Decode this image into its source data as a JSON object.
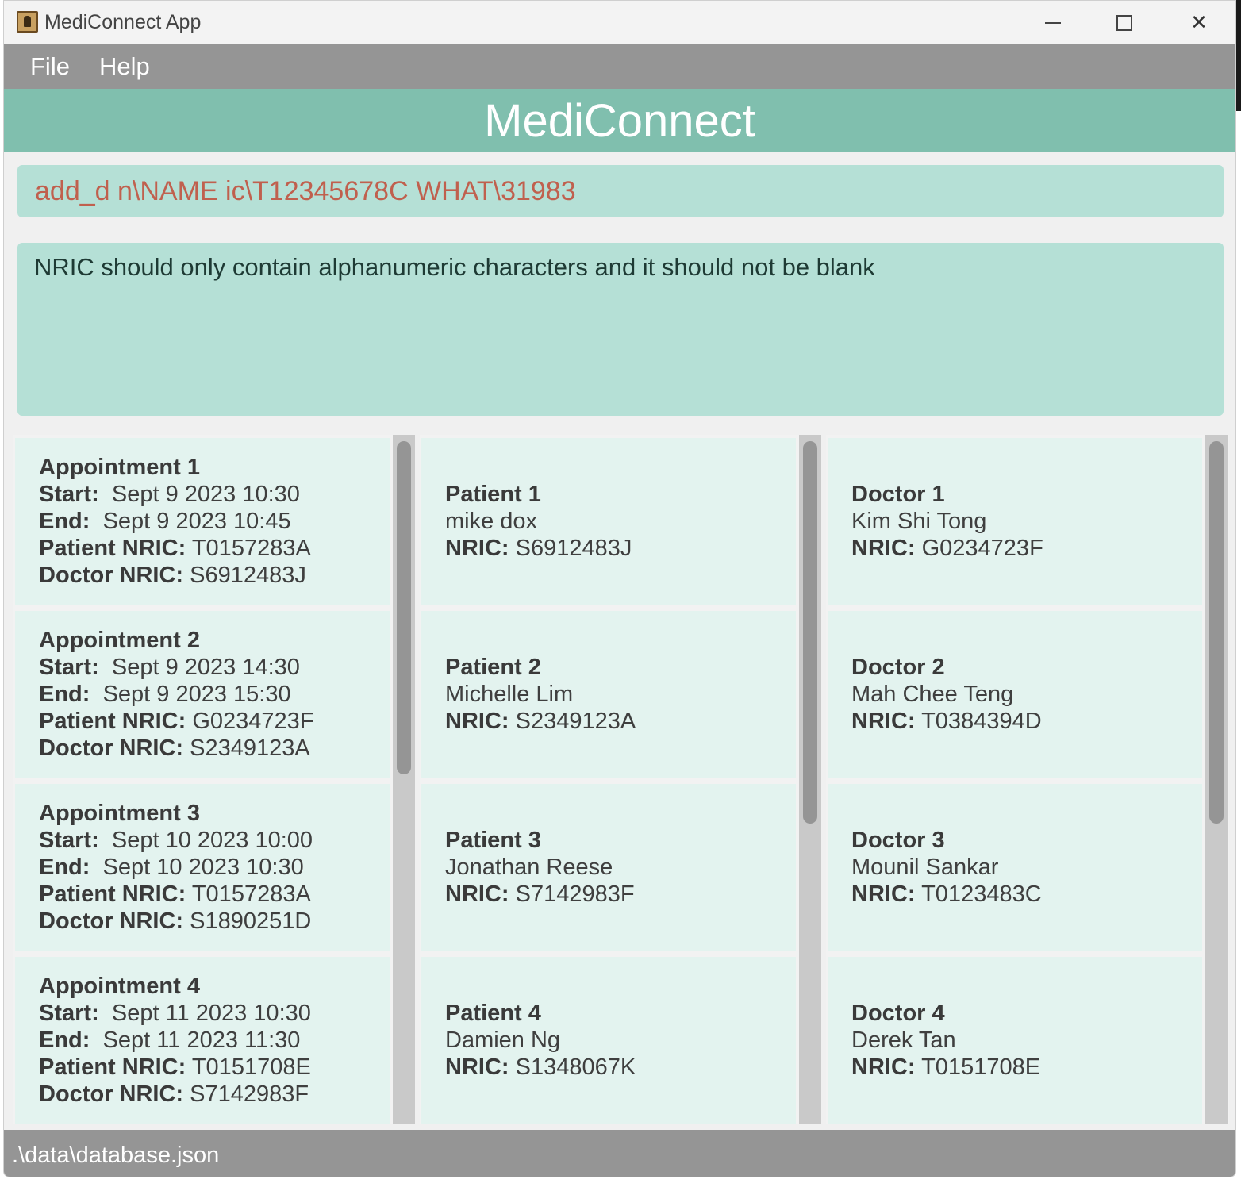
{
  "window": {
    "title": "MediConnect App"
  },
  "menu": {
    "file": "File",
    "help": "Help"
  },
  "banner": {
    "title": "MediConnect"
  },
  "command": {
    "value": "add_d n\\NAME ic\\T12345678C WHAT\\31983"
  },
  "result": {
    "message": "NRIC should only contain alphanumeric characters and it should not be blank"
  },
  "labels": {
    "start": "Start:",
    "end": "End:",
    "patient_nric": "Patient NRIC:",
    "doctor_nric": "Doctor NRIC:",
    "nric": "NRIC:"
  },
  "appointments": [
    {
      "title": "Appointment 1",
      "start": "Sept 9 2023 10:30",
      "end": "Sept 9 2023 10:45",
      "patient_nric": "T0157283A",
      "doctor_nric": "S6912483J"
    },
    {
      "title": "Appointment 2",
      "start": "Sept 9 2023 14:30",
      "end": "Sept 9 2023 15:30",
      "patient_nric": "G0234723F",
      "doctor_nric": "S2349123A"
    },
    {
      "title": "Appointment 3",
      "start": "Sept 10 2023 10:00",
      "end": "Sept 10 2023 10:30",
      "patient_nric": "T0157283A",
      "doctor_nric": "S1890251D"
    },
    {
      "title": "Appointment 4",
      "start": "Sept 11 2023 10:30",
      "end": "Sept 11 2023 11:30",
      "patient_nric": "T0151708E",
      "doctor_nric": "S7142983F"
    }
  ],
  "patients": [
    {
      "title": "Patient 1",
      "name": "mike dox",
      "nric": "S6912483J"
    },
    {
      "title": "Patient 2",
      "name": "Michelle Lim",
      "nric": "S2349123A"
    },
    {
      "title": "Patient 3",
      "name": "Jonathan Reese",
      "nric": "S7142983F"
    },
    {
      "title": "Patient 4",
      "name": "Damien Ng",
      "nric": "S1348067K"
    }
  ],
  "doctors": [
    {
      "title": "Doctor 1",
      "name": "Kim Shi Tong",
      "nric": "G0234723F"
    },
    {
      "title": "Doctor 2",
      "name": "Mah Chee Teng",
      "nric": "T0384394D"
    },
    {
      "title": "Doctor 3",
      "name": "Mounil Sankar",
      "nric": "T0123483C"
    },
    {
      "title": "Doctor 4",
      "name": "Derek Tan",
      "nric": "T0151708E"
    }
  ],
  "status": {
    "path": ".\\data\\database.json"
  },
  "colors": {
    "banner": "#80bfae",
    "input_bg": "#b5e0d6",
    "command_text": "#c0604e",
    "card_bg": "#e3f3ef",
    "bars": "#959595"
  }
}
